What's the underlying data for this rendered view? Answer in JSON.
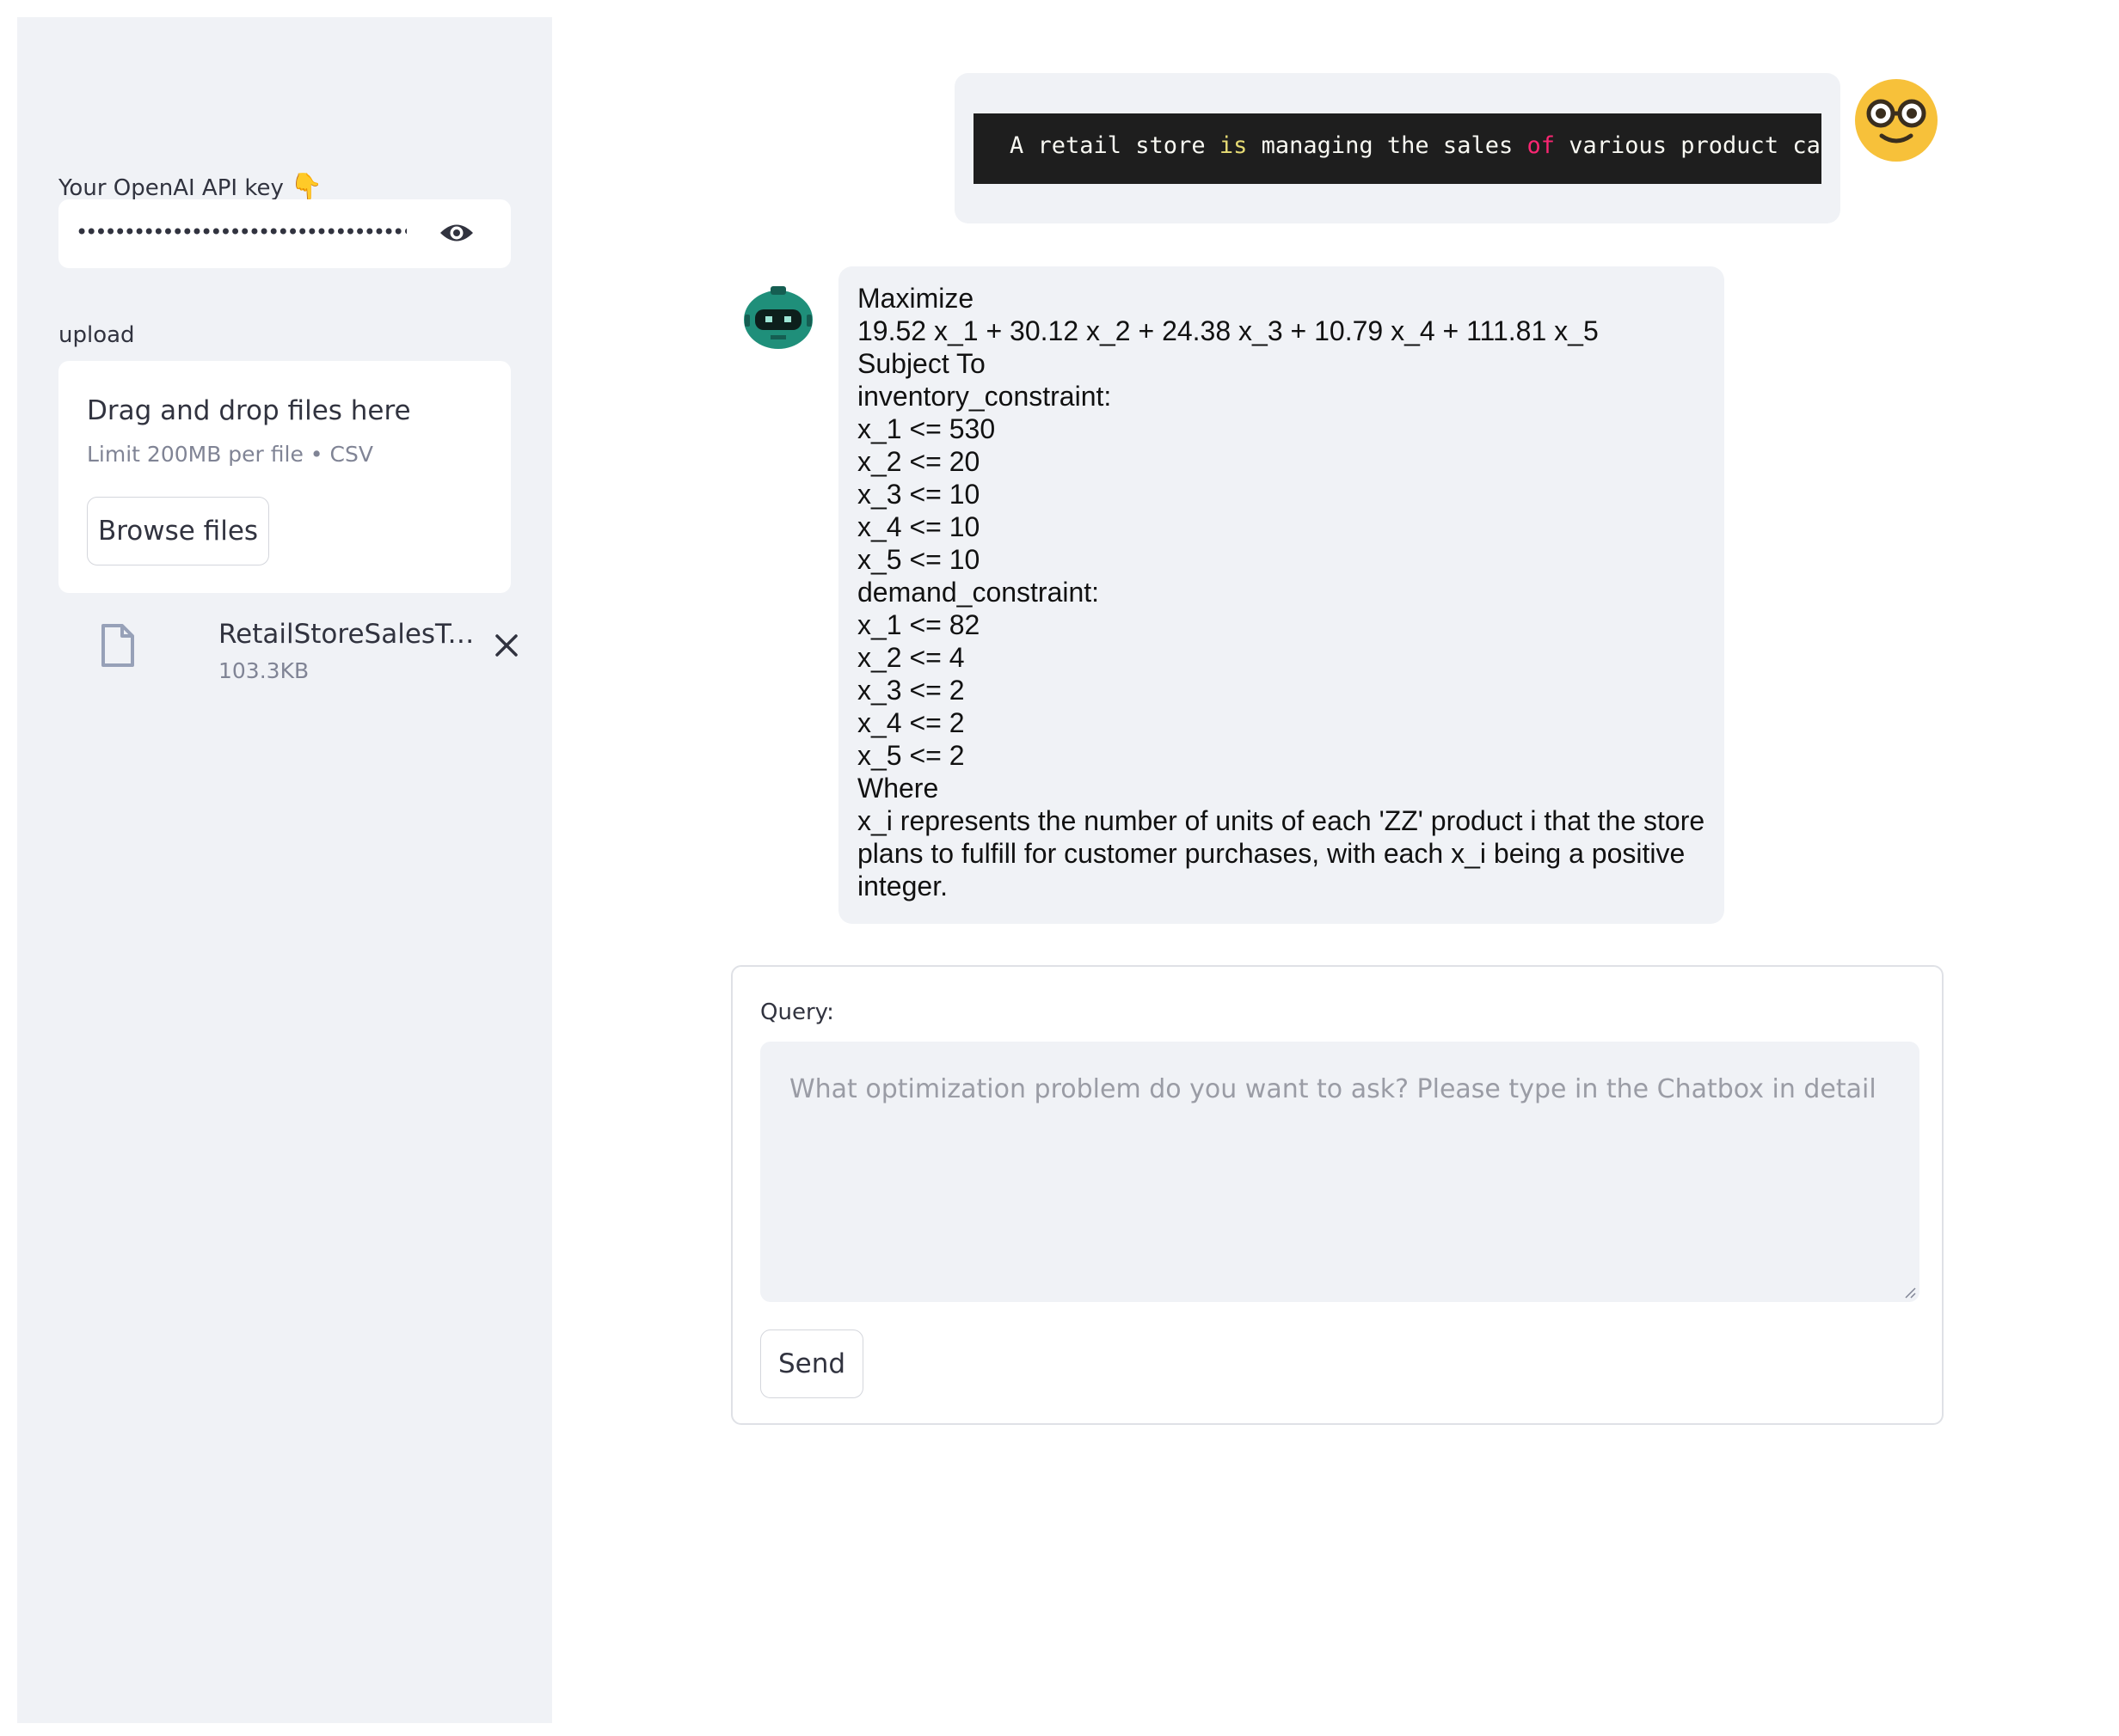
{
  "sidebar": {
    "api_key_label": "Your OpenAI API key",
    "api_key_emoji": "👇",
    "api_key_value": "••••••••••••••••••••••••••••••••••••••••••••••••••",
    "upload_label": "upload",
    "dropzone": {
      "title": "Drag and drop files here",
      "limit": "Limit 200MB per file • CSV",
      "browse_label": "Browse files"
    },
    "uploaded_file": {
      "name": "RetailStoreSalesTran…",
      "size": "103.3KB"
    }
  },
  "chat": {
    "user_message": {
      "code_parts": {
        "p1": "A retail store ",
        "p2": "is",
        "p3": " managing the sales ",
        "p4": "of",
        "p5": " various product categ"
      }
    },
    "bot_message": {
      "lines": [
        "Maximize",
        "19.52 x_1 + 30.12 x_2 + 24.38 x_3 + 10.79 x_4 + 111.81 x_5",
        "Subject To",
        "inventory_constraint:",
        "x_1 <= 530",
        "x_2 <= 20",
        "x_3 <= 10",
        "x_4 <= 10",
        "x_5 <= 10",
        "demand_constraint:",
        "x_1 <= 82",
        "x_2 <= 4",
        "x_3 <= 2",
        "x_4 <= 2",
        "x_5 <= 2",
        "Where",
        "x_i represents the number of units of each 'ZZ' product i that the store",
        "plans to fulfill for customer purchases, with each x_i being a positive",
        "integer."
      ]
    }
  },
  "form": {
    "query_label": "Query:",
    "query_placeholder": "What optimization problem do you want to ask? Please type in the Chatbox in detail",
    "send_label": "Send"
  },
  "colors": {
    "sidebar_bg": "#f0f2f6",
    "bubble_bg": "#f0f2f6",
    "code_bg": "#1e1e1e",
    "keyword_yellow": "#e6db74",
    "keyword_red": "#f92672",
    "bot_avatar_teal": "#1f8f7a",
    "user_avatar_yellow": "#f7c13a"
  },
  "icons": {
    "eye": "eye-icon",
    "file": "file-icon",
    "close": "close-icon",
    "user_avatar": "nerd-face-icon",
    "bot_avatar": "robot-icon"
  }
}
